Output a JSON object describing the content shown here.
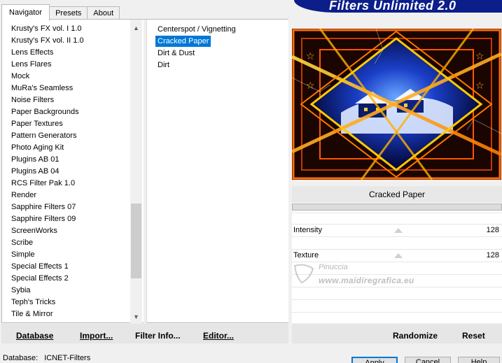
{
  "tabs": [
    {
      "label": "Navigator"
    },
    {
      "label": "Presets"
    },
    {
      "label": "About"
    }
  ],
  "banner": {
    "title": "Filters Unlimited 2.0"
  },
  "categories": [
    "Krusty's FX vol. I 1.0",
    "Krusty's FX vol. II 1.0",
    "Lens Effects",
    "Lens Flares",
    "Mock",
    "MuRa's Seamless",
    "Noise Filters",
    "Paper Backgrounds",
    "Paper Textures",
    "Pattern Generators",
    "Photo Aging Kit",
    "Plugins AB 01",
    "Plugins AB 04",
    "RCS Filter Pak 1.0",
    "Render",
    "Sapphire Filters 07",
    "Sapphire Filters 09",
    "ScreenWorks",
    "Scribe",
    "Simple",
    "Special Effects 1",
    "Special Effects 2",
    "Sybia",
    "Teph's Tricks",
    "Tile & Mirror"
  ],
  "filters": [
    {
      "label": "Centerspot / Vignetting",
      "selected": false
    },
    {
      "label": "Cracked Paper",
      "selected": true
    },
    {
      "label": "Dirt & Dust",
      "selected": false
    },
    {
      "label": "Dirt",
      "selected": false
    }
  ],
  "filter_name": "Cracked Paper",
  "params": [
    {
      "label": "Intensity",
      "value": "128"
    },
    {
      "label": "Texture",
      "value": "128"
    }
  ],
  "watermark": {
    "line1": "Pinuccia",
    "line2": "www.maidiregrafica.eu"
  },
  "left_buttons": {
    "database": "Database",
    "import": "Import...",
    "filter_info": "Filter Info...",
    "editor": "Editor..."
  },
  "right_buttons": {
    "randomize": "Randomize",
    "reset": "Reset"
  },
  "status": {
    "label": "Database:",
    "value": "ICNET-Filters"
  },
  "bottom_buttons": {
    "apply": "Apply",
    "cancel": "Cancel",
    "help": "Help"
  },
  "colors": {
    "selection": "#0078d7",
    "banner": "#0b1e8a"
  }
}
